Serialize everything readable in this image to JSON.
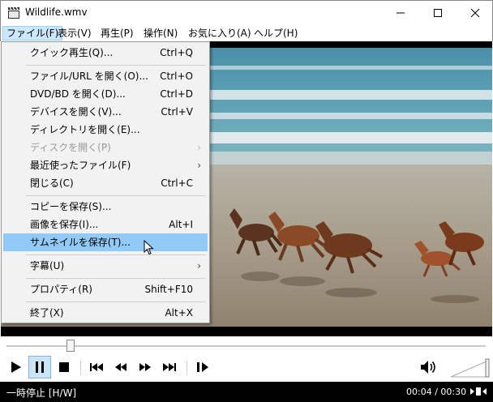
{
  "window": {
    "title": "Wildlife.wmv",
    "icons": [
      "clapperboard-icon",
      "minimize-icon",
      "maximize-icon",
      "close-icon"
    ]
  },
  "menubar": {
    "items": [
      {
        "label": "ファイル(F)"
      },
      {
        "label": "表示(V)"
      },
      {
        "label": "再生(P)"
      },
      {
        "label": "操作(N)"
      },
      {
        "label": "お気に入り(A)"
      },
      {
        "label": "ヘルプ(H)"
      }
    ]
  },
  "file_menu": {
    "items": [
      {
        "label": "クイック再生(Q)...",
        "shortcut": "Ctrl+Q"
      },
      {
        "label": "ファイル/URL を開く(O)...",
        "shortcut": "Ctrl+O"
      },
      {
        "label": "DVD/BD を開く(D)...",
        "shortcut": "Ctrl+D"
      },
      {
        "label": "デバイスを開く(V)...",
        "shortcut": "Ctrl+V"
      },
      {
        "label": "ディレクトリを開く(E)...",
        "shortcut": ""
      },
      {
        "label": "ディスクを開く(P)",
        "shortcut": ""
      },
      {
        "label": "最近使ったファイル(F)",
        "shortcut": ""
      },
      {
        "label": "閉じる(C)",
        "shortcut": "Ctrl+C"
      },
      {
        "label": "コピーを保存(S)...",
        "shortcut": ""
      },
      {
        "label": "画像を保存(I)...",
        "shortcut": "Alt+I"
      },
      {
        "label": "サムネイルを保存(T)...",
        "shortcut": ""
      },
      {
        "label": "字幕(U)",
        "shortcut": ""
      },
      {
        "label": "プロパティ(R)",
        "shortcut": "Shift+F10"
      },
      {
        "label": "終了(X)",
        "shortcut": "Alt+X"
      }
    ],
    "highlighted": "サムネイルを保存(T)..."
  },
  "playback": {
    "position_fraction": 0.133,
    "volume_fraction": 1.0
  },
  "status": {
    "state": "一時停止 [H/W]",
    "time": "00:04 / 00:30"
  },
  "colors": {
    "menu_highlight": "#91c9f7",
    "menubar_active": "#cce8ff",
    "pause_pressed": "#cce4f7",
    "status_bg": "#000000"
  }
}
